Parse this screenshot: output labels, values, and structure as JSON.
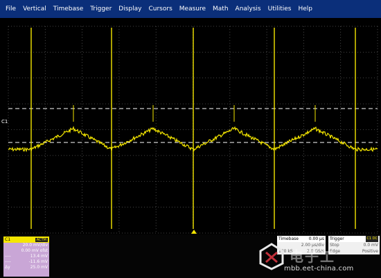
{
  "menu": [
    "File",
    "Vertical",
    "Timebase",
    "Trigger",
    "Display",
    "Cursors",
    "Measure",
    "Math",
    "Analysis",
    "Utilities",
    "Help"
  ],
  "colors": {
    "trace": "#f4e600",
    "grid": "#5a5a5a",
    "menubar": "#0b2f7a",
    "channel_panel": "#c9a6d6"
  },
  "channel_marker": "C1",
  "channel": {
    "name": "C1",
    "badge": "ACTM",
    "rows": [
      {
        "k": "",
        "v": "20.0 mV/div"
      },
      {
        "k": "",
        "v": "0.00 mV ofst"
      },
      {
        "k": "----",
        "v": "13.4 mV"
      },
      {
        "k": "----",
        "v": "-11.6 mV"
      },
      {
        "k": "Δy",
        "v": "25.0 mV"
      }
    ]
  },
  "timebase": {
    "label": "Timebase",
    "value": "0.00 µs",
    "row1": "2.00 µs/div",
    "row2_left": "100 kS",
    "row2_right": "2.0 GS/s"
  },
  "trigger": {
    "label": "Trigger",
    "badge": "C1 DC",
    "row1_left": "Stop",
    "row1_right": "0.0 mV",
    "row2_left": "Edge",
    "row2_right": "Positive"
  },
  "watermark": {
    "cn": "电子工",
    "url": "mbb.eet-china.com"
  }
}
